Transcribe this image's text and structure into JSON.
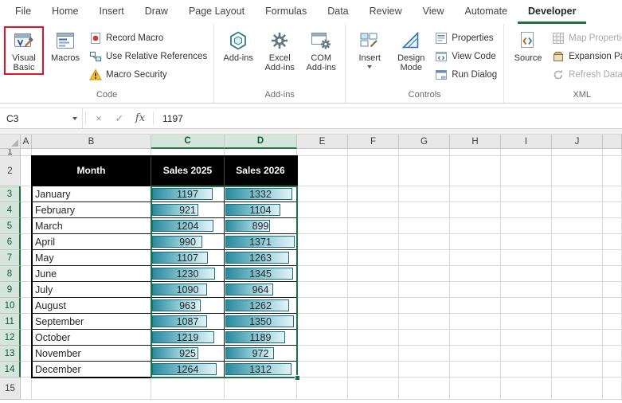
{
  "colors": {
    "accent_green": "#217346",
    "selection_green": "#1e7145",
    "annotation_red": "#e81123",
    "bar_border": "#14707e",
    "bar_fill_start": "#2a8a9e",
    "bar_fill_end": "#e3f3f6",
    "table_header_bg": "#000000"
  },
  "ribbon": {
    "tabs": [
      "File",
      "Home",
      "Insert",
      "Draw",
      "Page Layout",
      "Formulas",
      "Data",
      "Review",
      "View",
      "Automate",
      "Developer"
    ],
    "active_tab": "Developer",
    "code_group": {
      "label": "Code",
      "visual_basic": "Visual Basic",
      "macros": "Macros",
      "record_macro": "Record Macro",
      "use_relative_references": "Use Relative References",
      "macro_security": "Macro Security"
    },
    "addins_group": {
      "label": "Add-ins",
      "add_ins": "Add-ins",
      "excel_add_ins": "Excel Add-ins",
      "com_add_ins": "COM Add-ins"
    },
    "controls_group": {
      "label": "Controls",
      "insert": "Insert",
      "design_mode": "Design Mode",
      "properties": "Properties",
      "view_code": "View Code",
      "run_dialog": "Run Dialog"
    },
    "xml_group": {
      "label": "XML",
      "source": "Source",
      "map_properties": "Map Properties",
      "expansion_packs": "Expansion Packs",
      "refresh_data": "Refresh Data"
    }
  },
  "formula_bar": {
    "name_box": "C3",
    "cancel": "×",
    "enter": "✓",
    "fx": "fx",
    "value": "1197"
  },
  "sheet": {
    "column_headers": [
      "A",
      "B",
      "C",
      "D",
      "E",
      "F",
      "G",
      "H",
      "I",
      "J"
    ],
    "selected_columns": [
      "C",
      "D"
    ],
    "row_headers": [
      "1",
      "2",
      "3",
      "4",
      "5",
      "6",
      "7",
      "8",
      "9",
      "10",
      "11",
      "12",
      "13",
      "14",
      "15"
    ],
    "selected_rows": [
      "3",
      "4",
      "5",
      "6",
      "7",
      "8",
      "9",
      "10",
      "11",
      "12",
      "13",
      "14"
    ],
    "active_cell": "C3"
  },
  "table": {
    "headers": [
      "Month",
      "Sales 2025",
      "Sales 2026"
    ],
    "months": [
      "January",
      "February",
      "March",
      "April",
      "May",
      "June",
      "July",
      "August",
      "September",
      "October",
      "November",
      "December"
    ],
    "sales_2025": [
      1197,
      921,
      1204,
      990,
      1107,
      1230,
      1090,
      963,
      1087,
      1219,
      925,
      1264
    ],
    "sales_2026": [
      1332,
      1104,
      899,
      1371,
      1263,
      1345,
      964,
      1262,
      1350,
      1189,
      972,
      1312
    ]
  }
}
